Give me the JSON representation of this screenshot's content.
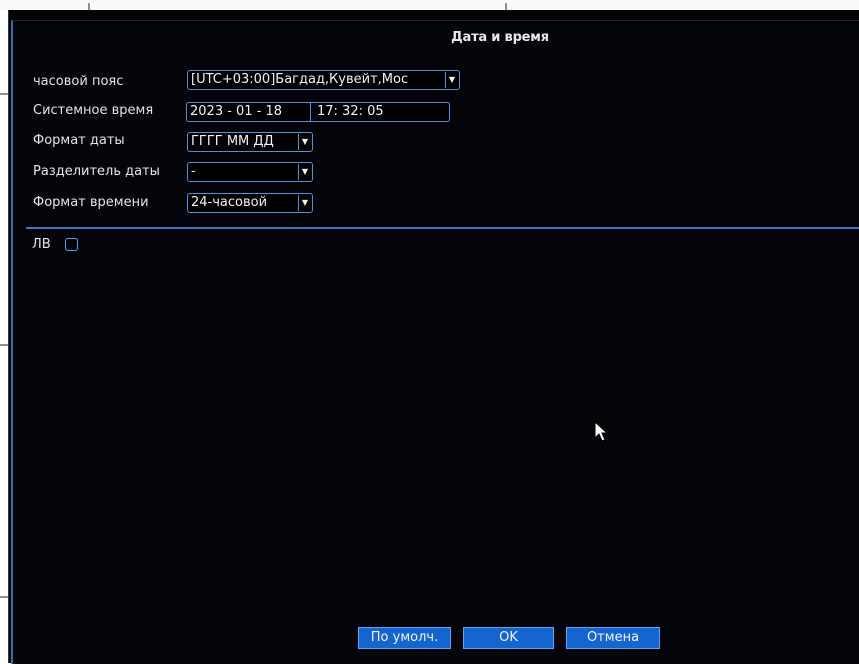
{
  "dialog": {
    "title": "Дата и время"
  },
  "fields": {
    "timezone": {
      "label": "часовой пояс",
      "value": "[UTC+03:00]Багдад,Кувейт,Мос"
    },
    "system_time": {
      "label": "Системное время",
      "date": "2023 - 01 - 18",
      "time": "17: 32: 05"
    },
    "date_format": {
      "label": "Формат даты",
      "value": "ГГГГ ММ ДД"
    },
    "date_separator": {
      "label": "Разделитель даты",
      "value": "-"
    },
    "time_format": {
      "label": "Формат времени",
      "value": "24-часовой"
    }
  },
  "dst": {
    "label": "ЛВ",
    "checked": false
  },
  "buttons": {
    "default": "По умолч.",
    "ok": "OK",
    "cancel": "Отмена"
  },
  "colors": {
    "accent": "#4d93d8",
    "button": "#1565d1",
    "background": "#03050a",
    "text": "#e4e4e4"
  },
  "icons": {
    "dropdown": "triangle-down-icon",
    "checkbox": "checkbox-empty-icon",
    "pointer": "mouse-pointer-icon"
  }
}
